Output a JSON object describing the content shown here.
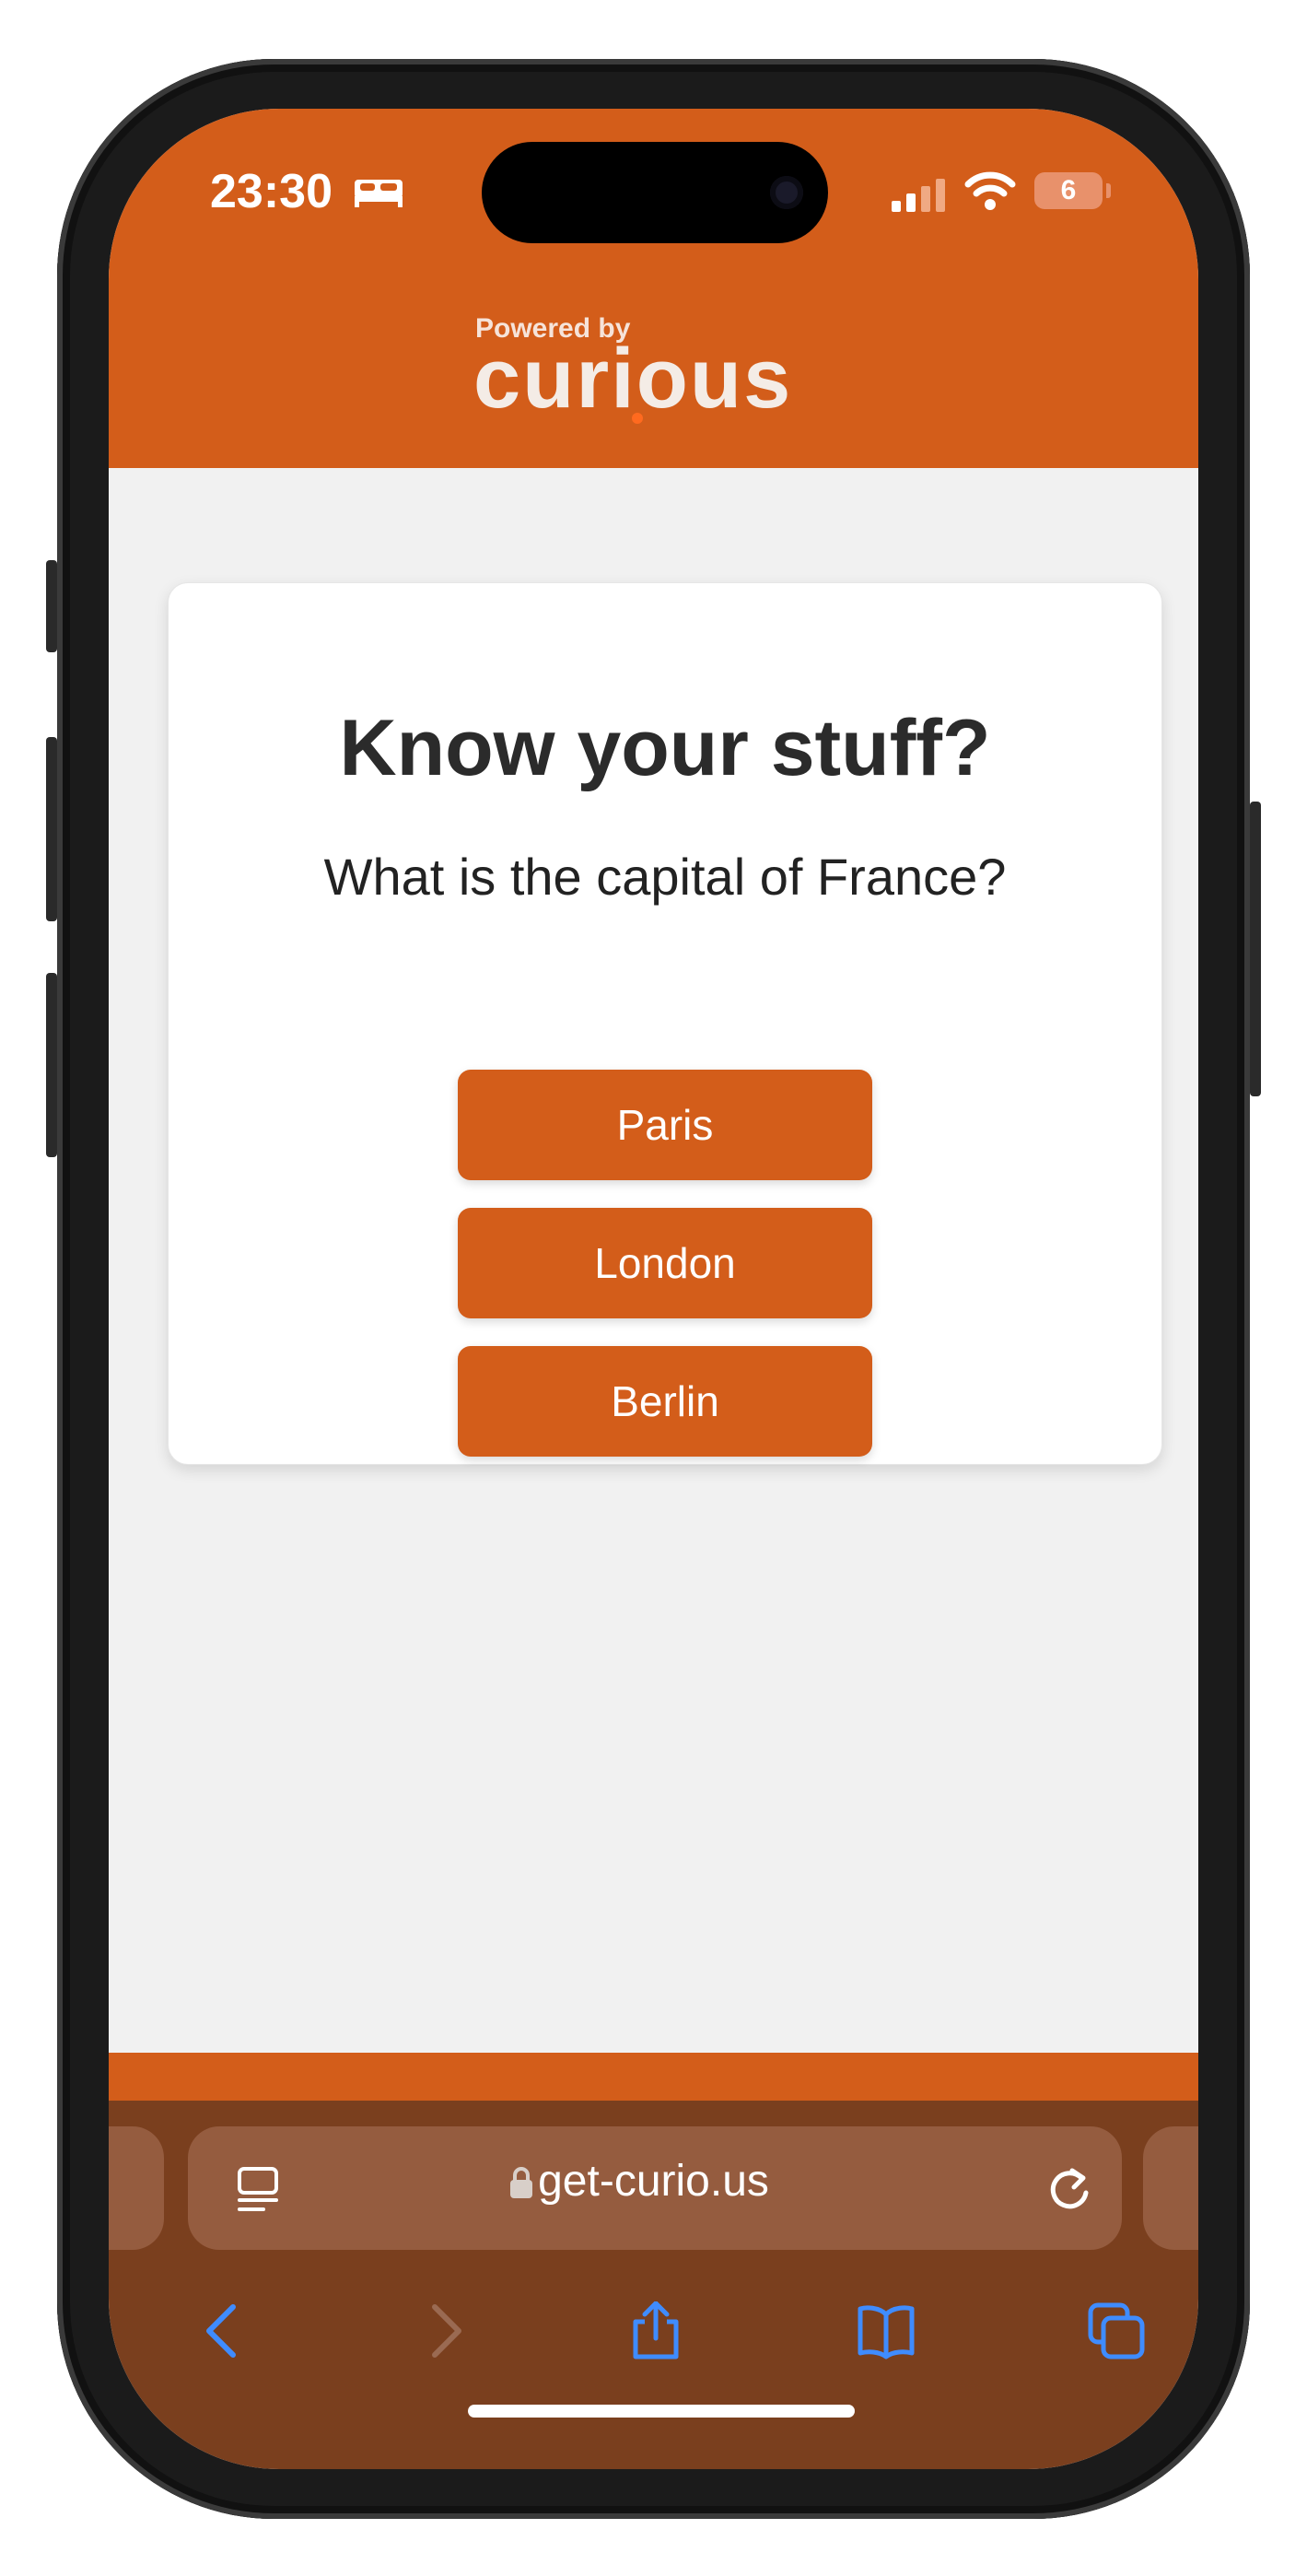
{
  "status_bar": {
    "time": "23:30",
    "battery_level": "6",
    "icons": [
      "bed-icon",
      "signal-icon",
      "wifi-icon",
      "battery-icon"
    ]
  },
  "header": {
    "powered_by": "Powered by",
    "brand": "curious",
    "background_color": "#d35d1a"
  },
  "card": {
    "title": "Know your stuff?",
    "question": "What is the capital of France?",
    "answers": [
      {
        "label": "Paris"
      },
      {
        "label": "London"
      },
      {
        "label": "Berlin"
      }
    ],
    "button_color": "#d35d1a"
  },
  "browser": {
    "url": "get-curio.us",
    "icons": [
      "reader-icon",
      "lock-icon",
      "reload-icon",
      "back-icon",
      "forward-icon",
      "share-icon",
      "bookmarks-icon",
      "tabs-icon"
    ],
    "bar_color": "#7a3f1e",
    "accent_color": "#3f8cff"
  }
}
